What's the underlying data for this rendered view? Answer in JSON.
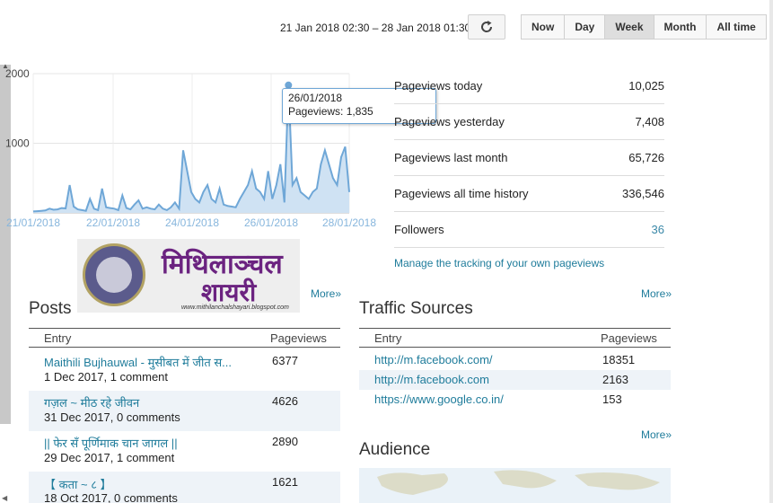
{
  "header": {
    "date_range": "21 Jan 2018 02:30 – 28 Jan 2018 01:30",
    "refresh_icon": "refresh-icon",
    "range_buttons": [
      {
        "label": "Now",
        "active": false
      },
      {
        "label": "Day",
        "active": false
      },
      {
        "label": "Week",
        "active": true
      },
      {
        "label": "Month",
        "active": false
      },
      {
        "label": "All time",
        "active": false
      }
    ]
  },
  "chart_data": {
    "type": "area",
    "x_tick_labels": [
      "21/01/2018",
      "22/01/2018",
      "24/01/2018",
      "26/01/2018",
      "28/01/2018"
    ],
    "y_ticks": [
      1000,
      2000
    ],
    "ylim": [
      0,
      2000
    ],
    "series_color": "#6fa7d7",
    "fill_color": "#cfe2f3",
    "values": [
      20,
      25,
      30,
      35,
      60,
      45,
      50,
      70,
      65,
      400,
      90,
      50,
      40,
      30,
      200,
      60,
      40,
      350,
      80,
      70,
      60,
      40,
      250,
      70,
      50,
      120,
      180,
      60,
      80,
      60,
      50,
      120,
      60,
      40,
      80,
      150,
      60,
      900,
      600,
      300,
      200,
      150,
      300,
      400,
      200,
      150,
      350,
      120,
      100,
      90,
      80,
      200,
      300,
      400,
      600,
      350,
      300,
      200,
      600,
      200,
      400,
      700,
      150,
      1835,
      400,
      500,
      300,
      250,
      200,
      300,
      350,
      700,
      900,
      700,
      500,
      400,
      800,
      950,
      300
    ],
    "peak_index": 63,
    "tooltip": {
      "date": "26/01/2018",
      "text": "Pageviews: 1,835"
    }
  },
  "stats": [
    {
      "label": "Pageviews today",
      "value": "10,025"
    },
    {
      "label": "Pageviews yesterday",
      "value": "7,408"
    },
    {
      "label": "Pageviews last month",
      "value": "65,726"
    },
    {
      "label": "Pageviews all time history",
      "value": "336,546"
    },
    {
      "label": "Followers",
      "value": "36"
    }
  ],
  "manage_link": "Manage the tracking of your own pageviews",
  "banner": {
    "line1": "मिथिलाञ्चल",
    "line2": "शायरी",
    "url": "www.mithilanchalshayari.blogspot.com"
  },
  "posts": {
    "title": "Posts",
    "more": "More»",
    "columns": [
      "Entry",
      "Pageviews"
    ],
    "rows": [
      {
        "title": "Maithili Bujhauwal - मुसीबत में जीत स...",
        "meta": "1 Dec 2017, 1 comment",
        "views": "6377"
      },
      {
        "title": "गज़ल ~ मीठ रहे जीवन",
        "meta": "31 Dec 2017, 0 comments",
        "views": "4626"
      },
      {
        "title": "|| फेर सँ पूर्णिमाक चान जागल ||",
        "meta": "29 Dec 2017, 1 comment",
        "views": "2890"
      },
      {
        "title": "【 कता ~ ८ 】",
        "meta": "18 Oct 2017, 0 comments",
        "views": "1621"
      }
    ]
  },
  "traffic": {
    "title": "Traffic Sources",
    "more": "More»",
    "columns": [
      "Entry",
      "Pageviews"
    ],
    "rows": [
      {
        "url": "http://m.facebook.com/",
        "views": "18351"
      },
      {
        "url": "http://m.facebook.com",
        "views": "2163"
      },
      {
        "url": "https://www.google.co.in/",
        "views": "153"
      }
    ]
  },
  "audience": {
    "title": "Audience",
    "more": "More»"
  }
}
